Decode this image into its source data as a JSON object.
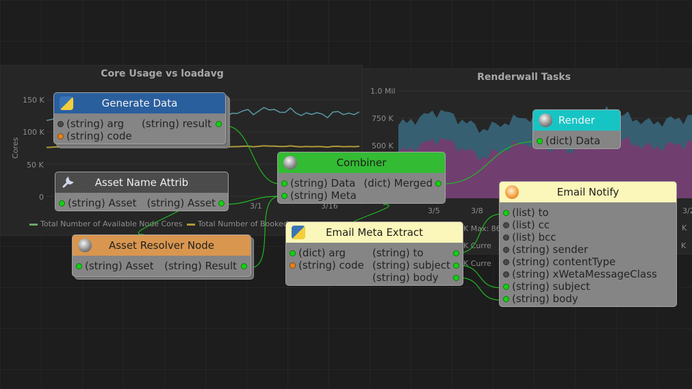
{
  "charts": {
    "left": {
      "title": "Core Usage vs loadavg",
      "ylabel": "Cores",
      "y_ticks": [
        "150 K",
        "100 K",
        "50 K",
        "0"
      ],
      "x_ticks": [
        "3/1",
        "3/16"
      ],
      "legend": [
        "Total Number of Available Node Cores",
        "Total Number of Booked"
      ]
    },
    "right": {
      "title": "Renderwall Tasks",
      "y_ticks": [
        "1.0 Mil",
        "750 K",
        "500 K"
      ],
      "x_ticks": [
        "3/5",
        "3/8",
        "3/2"
      ],
      "stats": [
        "K  Max: 86",
        "K  Curre",
        "K  Curre"
      ],
      "edge_labels": [
        "K",
        "K"
      ]
    }
  },
  "chart_data": [
    {
      "type": "line",
      "title": "Core Usage vs loadavg",
      "ylabel": "Cores",
      "ylim": [
        0,
        160000
      ],
      "series": [
        {
          "name": "Total Number of Available Node Cores",
          "values": [
            118000,
            124000,
            121000,
            133000,
            128000,
            135000,
            127000,
            130000
          ]
        },
        {
          "name": "Total Number of Booked",
          "values": [
            76000,
            77000,
            76500,
            77500,
            77000,
            78000,
            77000,
            77500
          ]
        }
      ]
    },
    {
      "type": "area",
      "title": "Renderwall Tasks",
      "ylim": [
        0,
        1000000
      ],
      "series": [
        {
          "values": [
            680000,
            820000,
            640000,
            760000,
            690000,
            810000,
            700000,
            760000
          ]
        },
        {
          "values": [
            420000,
            560000,
            380000,
            520000,
            440000,
            580000,
            470000,
            520000
          ]
        }
      ]
    }
  ],
  "nodes": {
    "generate_data": {
      "title": "Generate Data",
      "icon": "python-icon",
      "color": "#2a5f9e",
      "ports": [
        {
          "left": "(string) arg",
          "right": "(string) result"
        },
        {
          "left": "(string) code",
          "right": ""
        }
      ]
    },
    "asset_name_attrib": {
      "title": "Asset Name Attrib",
      "icon": "wrench-icon",
      "color": "#4b4b4b",
      "ports": [
        {
          "left": "(string) Asset",
          "right": "(string) Asset"
        }
      ]
    },
    "asset_resolver": {
      "title": "Asset Resolver Node",
      "icon": "sphere-icon",
      "color": "#d9964f",
      "ports": [
        {
          "left": "(string) Asset",
          "right": "(string) Result"
        }
      ]
    },
    "combiner": {
      "title": "Combiner",
      "icon": "sphere-icon",
      "color": "#33bb33",
      "ports": [
        {
          "left": "(string) Data",
          "right": "(dict) Merged"
        },
        {
          "left": "(string) Meta",
          "right": ""
        }
      ]
    },
    "email_meta_extract": {
      "title": "Email Meta Extract",
      "icon": "python-icon",
      "color": "#fbf6b9",
      "ports": [
        {
          "left": "(dict) arg",
          "right": "(string) to"
        },
        {
          "left": "(string) code",
          "right": "(string) subject"
        },
        {
          "left": "",
          "right": "(string) body"
        }
      ]
    },
    "render": {
      "title": "Render",
      "icon": "sphere-icon",
      "color": "#17c4c4",
      "ports": [
        {
          "left": "(dict) Data",
          "right": ""
        }
      ]
    },
    "email_notify": {
      "title": "Email Notify",
      "icon": "mail-icon",
      "color": "#fbf6b9",
      "ports": [
        {
          "left": "(list) to"
        },
        {
          "left": "(list) cc"
        },
        {
          "left": "(list) bcc"
        },
        {
          "left": "(string) sender"
        },
        {
          "left": "(string) contentType"
        },
        {
          "left": "(string) xWetaMessageClass"
        },
        {
          "left": "(string) subject"
        },
        {
          "left": "(string) body"
        }
      ]
    }
  },
  "colors": {
    "wire": "#22b822",
    "port_connected": "#16d016",
    "port_code": "#e58320",
    "port_unconnected": "#4a4a4a",
    "canvas_bg": "#1d1d1d"
  }
}
